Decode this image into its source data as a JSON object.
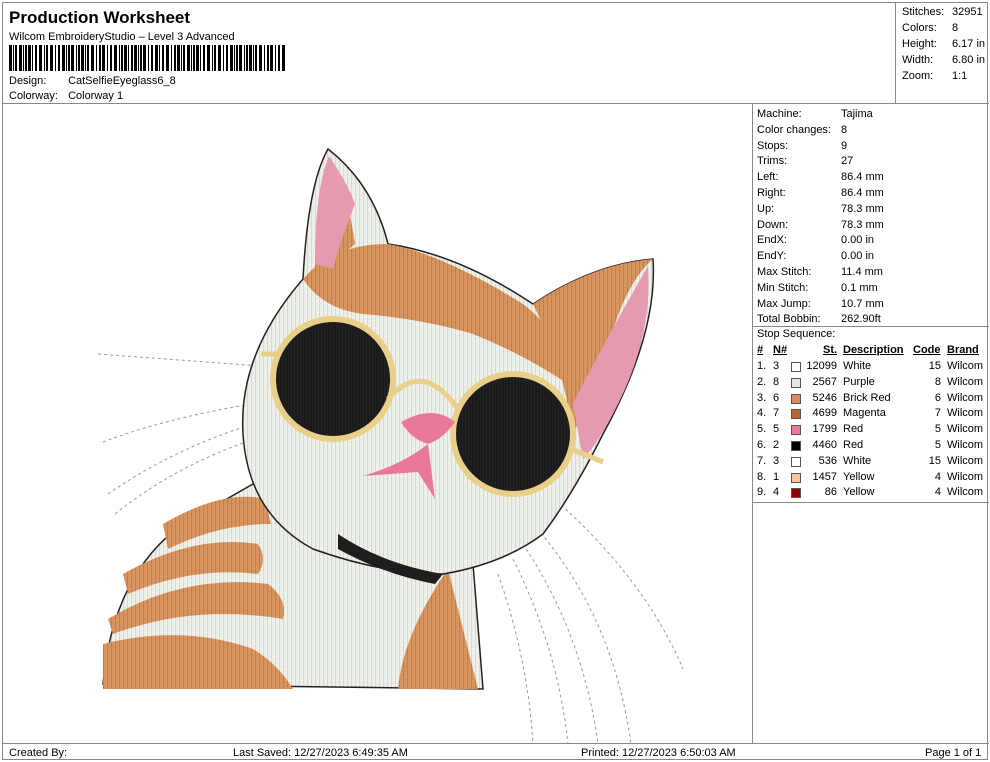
{
  "header": {
    "title": "Production Worksheet",
    "subtitle": "Wilcom EmbroideryStudio – Level 3 Advanced",
    "design_label": "Design:",
    "design_value": "CatSelfieEyeglass6_8",
    "colorway_label": "Colorway:",
    "colorway_value": "Colorway 1"
  },
  "stats": [
    {
      "label": "Stitches:",
      "value": "32951"
    },
    {
      "label": "Colors:",
      "value": "8"
    },
    {
      "label": "Height:",
      "value": "6.17 in"
    },
    {
      "label": "Width:",
      "value": "6.80 in"
    },
    {
      "label": "Zoom:",
      "value": "1:1"
    }
  ],
  "machine": [
    {
      "label": "Machine:",
      "value": "Tajima"
    },
    {
      "label": "Color changes:",
      "value": "8"
    },
    {
      "label": "Stops:",
      "value": "9"
    },
    {
      "label": "Trims:",
      "value": "27"
    },
    {
      "label": "Left:",
      "value": "86.4 mm"
    },
    {
      "label": "Right:",
      "value": "86.4 mm"
    },
    {
      "label": "Up:",
      "value": "78.3 mm"
    },
    {
      "label": "Down:",
      "value": "78.3 mm"
    },
    {
      "label": "EndX:",
      "value": "0.00 in"
    },
    {
      "label": "EndY:",
      "value": "0.00 in"
    },
    {
      "label": "Max Stitch:",
      "value": "11.4 mm"
    },
    {
      "label": "Min Stitch:",
      "value": "0.1 mm"
    },
    {
      "label": "Max Jump:",
      "value": "10.7 mm"
    },
    {
      "label": "Total Bobbin:",
      "value": "262.90ft"
    }
  ],
  "stop_sequence": {
    "title": "Stop Sequence:",
    "headers": {
      "num": "#",
      "n": "N#",
      "st": "St.",
      "desc": "Description",
      "code": "Code",
      "brand": "Brand"
    },
    "rows": [
      {
        "num": "1.",
        "n": "3",
        "color": "#ffffff",
        "st": "12099",
        "desc": "White",
        "code": "15",
        "brand": "Wilcom"
      },
      {
        "num": "2.",
        "n": "8",
        "color": "#e6e6e6",
        "st": "2567",
        "desc": "Purple",
        "code": "8",
        "brand": "Wilcom"
      },
      {
        "num": "3.",
        "n": "6",
        "color": "#d98a60",
        "st": "5246",
        "desc": "Brick Red",
        "code": "6",
        "brand": "Wilcom"
      },
      {
        "num": "4.",
        "n": "7",
        "color": "#b5653a",
        "st": "4699",
        "desc": "Magenta",
        "code": "7",
        "brand": "Wilcom"
      },
      {
        "num": "5.",
        "n": "5",
        "color": "#e8799a",
        "st": "1799",
        "desc": "Red",
        "code": "5",
        "brand": "Wilcom"
      },
      {
        "num": "6.",
        "n": "2",
        "color": "#000000",
        "st": "4460",
        "desc": "Red",
        "code": "5",
        "brand": "Wilcom"
      },
      {
        "num": "7.",
        "n": "3",
        "color": "#ffffff",
        "st": "536",
        "desc": "White",
        "code": "15",
        "brand": "Wilcom"
      },
      {
        "num": "8.",
        "n": "1",
        "color": "#f4c89a",
        "st": "1457",
        "desc": "Yellow",
        "code": "4",
        "brand": "Wilcom"
      },
      {
        "num": "9.",
        "n": "4",
        "color": "#8b0000",
        "st": "86",
        "desc": "Yellow",
        "code": "4",
        "brand": "Wilcom"
      }
    ]
  },
  "footer": {
    "created": "Created By:",
    "saved": "Last Saved: 12/27/2023 6:49:35 AM",
    "printed": "Printed: 12/27/2023 6:50:03 AM",
    "page": "Page 1 of 1"
  }
}
